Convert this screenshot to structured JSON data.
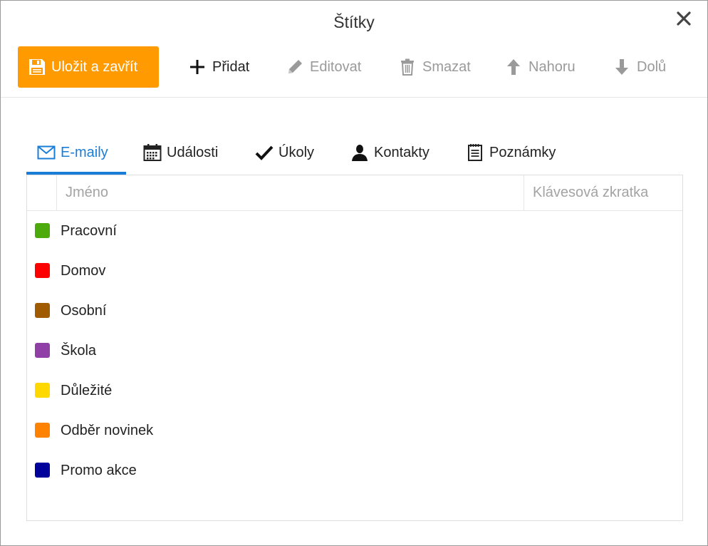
{
  "dialog": {
    "title": "Štítky"
  },
  "toolbar": {
    "save_close": "Uložit a zavřít",
    "add": "Přidat",
    "edit": "Editovat",
    "delete": "Smazat",
    "up": "Nahoru",
    "down": "Dolů"
  },
  "tabs": [
    {
      "label": "E-maily",
      "icon": "envelope-icon",
      "active": true
    },
    {
      "label": "Události",
      "icon": "calendar-icon"
    },
    {
      "label": "Úkoly",
      "icon": "checkmark-icon"
    },
    {
      "label": "Kontakty",
      "icon": "person-icon"
    },
    {
      "label": "Poznámky",
      "icon": "notepad-icon"
    }
  ],
  "table": {
    "columns": {
      "name": "Jméno",
      "shortcut": "Klávesová zkratka"
    },
    "rows": [
      {
        "name": "Pracovní",
        "color": "#4caa0c"
      },
      {
        "name": "Domov",
        "color": "#ff0000"
      },
      {
        "name": "Osobní",
        "color": "#a05a00"
      },
      {
        "name": "Škola",
        "color": "#8f3fa6"
      },
      {
        "name": "Důležité",
        "color": "#ffd800"
      },
      {
        "name": "Odběr novinek",
        "color": "#ff8200"
      },
      {
        "name": "Promo akce",
        "color": "#00009a"
      }
    ]
  },
  "colors": {
    "accent": "#ff9a00",
    "tab_active": "#1a7ed8",
    "disabled": "#9a9a9a"
  }
}
